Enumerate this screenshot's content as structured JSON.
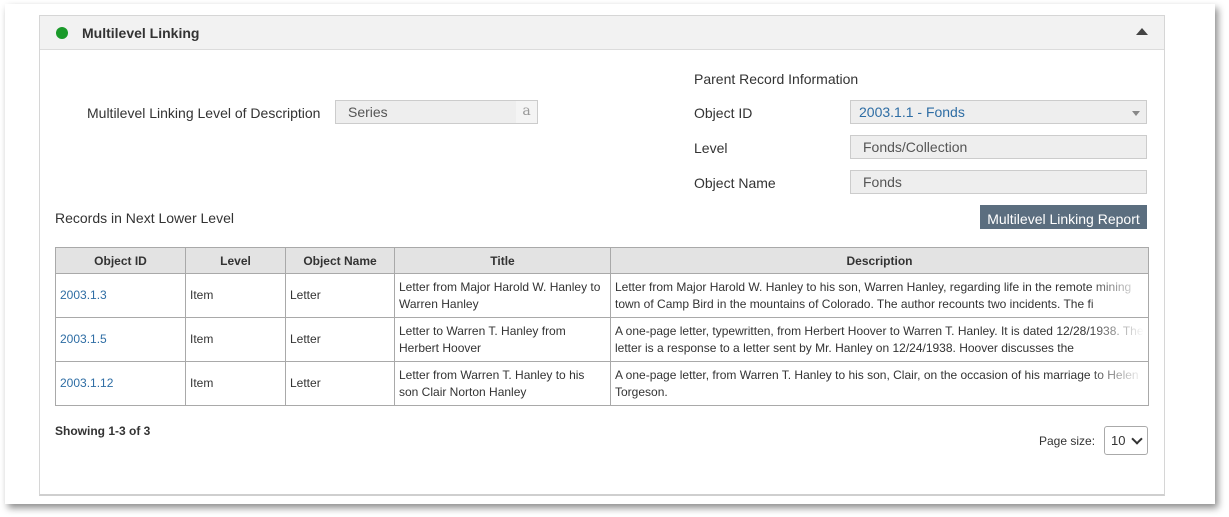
{
  "panel": {
    "title": "Multilevel Linking",
    "status_color": "#1a9a2a",
    "collapse_icon": "chevron-up-icon"
  },
  "level_of_description": {
    "label": "Multilevel Linking Level of Description",
    "value": "Series",
    "suffix": "a"
  },
  "parent": {
    "heading": "Parent Record Information",
    "object_id_label": "Object ID",
    "object_id_value": "2003.1.1 - Fonds",
    "level_label": "Level",
    "level_value": "Fonds/Collection",
    "object_name_label": "Object Name",
    "object_name_value": "Fonds"
  },
  "records": {
    "heading": "Records in Next Lower Level",
    "report_button": "Multilevel Linking Report",
    "columns": [
      "Object ID",
      "Level",
      "Object Name",
      "Title",
      "Description"
    ],
    "rows": [
      {
        "object_id": "2003.1.3",
        "level": "Item",
        "object_name": "Letter",
        "title": "Letter from Major Harold W. Hanley to Warren Hanley",
        "description": "Letter from Major Harold W. Hanley to his son, Warren Hanley, regarding life in the  remote mining town of Camp Bird in the mountains of Colorado.  The author recounts two incidents.  The fi"
      },
      {
        "object_id": "2003.1.5",
        "level": "Item",
        "object_name": "Letter",
        "title": "Letter to Warren T. Hanley from Herbert Hoover",
        "description": "A one-page letter, typewritten, from Herbert Hoover to Warren T. Hanley. It is dated 12/28/1938. The letter is a response to a letter sent by Mr. Hanley on 12/24/1938. Hoover discusses the"
      },
      {
        "object_id": "2003.1.12",
        "level": "Item",
        "object_name": "Letter",
        "title": "Letter from Warren T. Hanley to his son Clair Norton Hanley",
        "description": "A one-page letter, from Warren T. Hanley to his son, Clair, on the occasion of his marriage to Helen Torgeson."
      }
    ],
    "showing": "Showing 1-3 of 3",
    "page_size_label": "Page size:",
    "page_size_value": "10"
  },
  "colors": {
    "link": "#2e6da4",
    "button_bg": "#5b6e7f",
    "header_bg": "#f2f2f2"
  }
}
